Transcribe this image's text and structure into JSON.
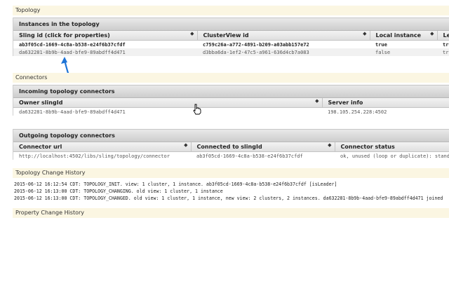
{
  "sections": {
    "topology": "Topology",
    "connectors": "Connectors",
    "change_history": "Topology Change History",
    "property_history": "Property Change History"
  },
  "instances": {
    "title": "Instances in the topology",
    "columns": [
      "Sling id (click for properties)",
      "ClusterView id",
      "Local instance",
      "Lea"
    ],
    "rows": [
      [
        "ab3f05cd-1669-4c8a-b538-e24f6b37cfdf",
        "c759c26a-a772-4891-b209-a03abb157e72",
        "true",
        "tru"
      ],
      [
        "da632281-8b9b-4aad-bfe9-89abdff4d471",
        "d3bba6da-1ef2-47c5-a961-636d4cb7a083",
        "false",
        "tru"
      ]
    ]
  },
  "incoming": {
    "title": "Incoming topology connectors",
    "columns": [
      "Owner slingId",
      "Server info"
    ],
    "rows": [
      [
        "da632281-8b9b-4aad-bfe9-89abdff4d471",
        "198.105.254.228:4502"
      ]
    ]
  },
  "outgoing": {
    "title": "Outgoing topology connectors",
    "columns": [
      "Connector url",
      "Connected to slingId",
      "Connector status"
    ],
    "rows": [
      [
        "http://localhost:4502/libs/sling/topology/connector",
        "ab3f05cd-1669-4c8a-b538-e24f6b37cfdf",
        "ok, unused (loop or duplicate): standby"
      ]
    ]
  },
  "history": [
    "2015-06-12 16:12:54 CDT: TOPOLOGY_INIT. view: 1 cluster, 1 instance. ab3f05cd-1669-4c8a-b538-e24f6b37cfdf [isLeader]",
    "2015-06-12 16:13:00 CDT: TOPOLOGY_CHANGING. old view: 1 cluster, 1 instance",
    "2015-06-12 16:13:00 CDT: TOPOLOGY_CHANGED. old view: 1 cluster, 1 instance, new view: 2 clusters, 2 instances. da632281-8b9b-4aad-bfe9-89abdff4d471 joined"
  ],
  "colors": {
    "section_bg": "#fbf6e2",
    "arrow": "#1e74d6"
  }
}
